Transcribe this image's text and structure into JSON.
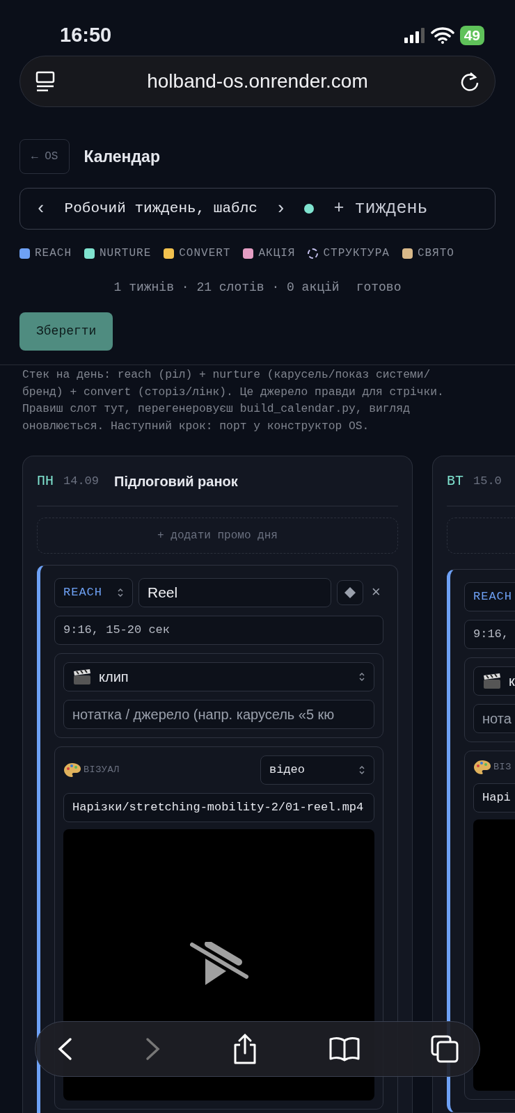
{
  "status_bar": {
    "time": "16:50",
    "battery": "49"
  },
  "browser": {
    "url": "holband-os.onrender.com"
  },
  "header": {
    "back": "← OS",
    "title": "Календар"
  },
  "week_bar": {
    "prev": "‹",
    "week": "Робочий тиждень, шаблс",
    "next": "›",
    "add": "+ тиждень"
  },
  "legend": [
    {
      "label": "REACH",
      "color": "#6ea1f5",
      "kind": "solid"
    },
    {
      "label": "NURTURE",
      "color": "#7fe3cf",
      "kind": "solid"
    },
    {
      "label": "CONVERT",
      "color": "#f2c14e",
      "kind": "solid"
    },
    {
      "label": "АКЦІЯ",
      "color": "#e59ec4",
      "kind": "solid"
    },
    {
      "label": "СТРУКТУРА",
      "color": "#c7c2ef",
      "kind": "dashed"
    },
    {
      "label": "СВЯТО",
      "color": "#d9b98a",
      "kind": "solid"
    }
  ],
  "stats": "1 тижнів · 21 слотів · 0 акцій",
  "status": "готово",
  "save": "Зберегти",
  "note": "Стек на день: reach (ріл) + nurture (карусель/показ системи/ бренд) + convert (сторіз/лінк). Це джерело правди для стрічки. Правиш слот тут, перегенеровуєш build_calendar.py, вигляд оновлюється. Наступний крок: порт у конструктор OS.",
  "days": [
    {
      "day": "ПН",
      "date": "14.09",
      "title": "Підлоговий ранок",
      "promo": "+ додати промо дня",
      "slots": [
        {
          "type": "REACH",
          "color": "#6ea1f5",
          "format": "Reel",
          "spec": "9:16, 15-20 сек",
          "clip": "клип",
          "note_placeholder": "нотатка / джерело (напр. карусель «5 кю",
          "visual_label": "ВІЗУАЛ",
          "visual_type": "відео",
          "path": "Нарізки/stretching-mobility-2/01-reel.mp4",
          "close": "×"
        }
      ]
    },
    {
      "day": "ВТ",
      "date": "15.0",
      "slots": [
        {
          "type": "REACH",
          "color": "#6ea1f5",
          "spec": "9:16,",
          "clip": "к",
          "note_placeholder": "нота",
          "visual_label": "ВІЗ",
          "path": "Нарі"
        }
      ],
      "empty_promo": true
    }
  ]
}
